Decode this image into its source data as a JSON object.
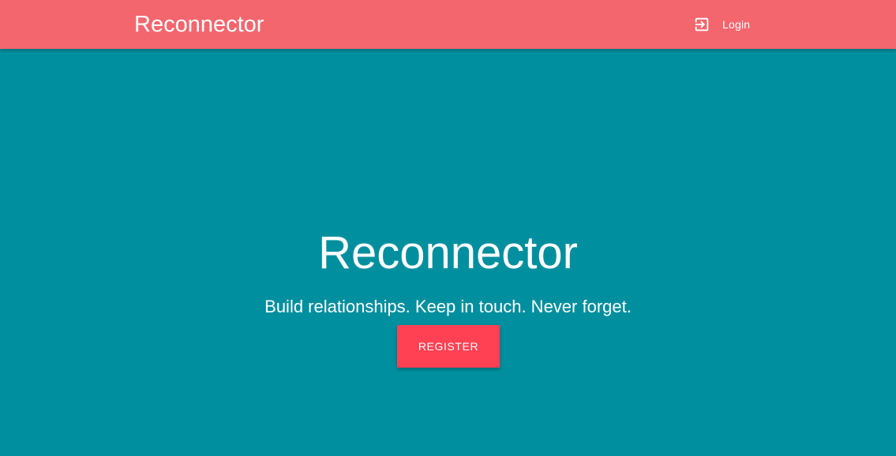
{
  "header": {
    "brand": "Reconnector",
    "login_icon": "login-icon",
    "login_label": "Login"
  },
  "hero": {
    "title": "Reconnector",
    "tagline": "Build relationships. Keep in touch. Never forget.",
    "register_label": "REGISTER"
  },
  "colors": {
    "header_bg": "#f3666e",
    "page_bg": "#008f9e",
    "button_bg": "#ff4153",
    "text": "#ffffff"
  }
}
